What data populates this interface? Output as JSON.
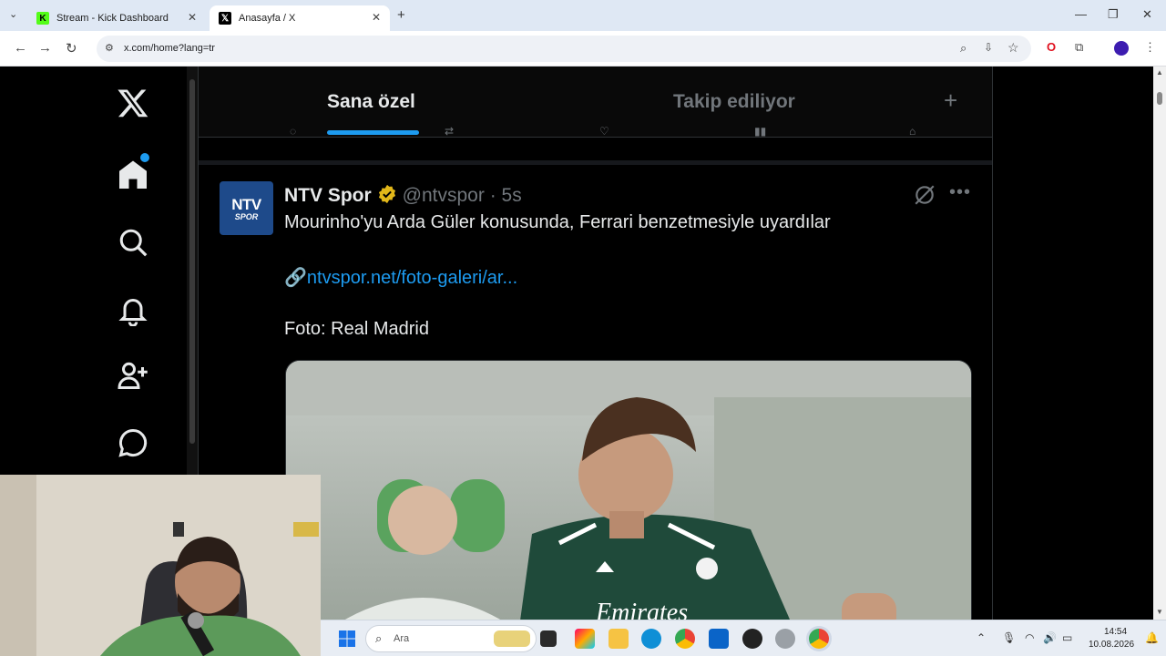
{
  "browser": {
    "tabs": [
      {
        "title": "Stream - Kick Dashboard",
        "favicon": "kick-icon"
      },
      {
        "title": "Anasayfa / X",
        "favicon": "x-icon"
      }
    ],
    "url": "x.com/home?lang=tr"
  },
  "feed": {
    "tab_for_you": "Sana özel",
    "tab_following": "Takip ediliyor"
  },
  "post": {
    "avatar_line1": "NTV",
    "avatar_line2": "SPOR",
    "author_name": "NTV Spor",
    "author_handle": "@ntvspor",
    "separator": "·",
    "time": "5s",
    "text": "Mourinho'yu Arda Güler konusunda, Ferrari benzetmesiyle uyardılar",
    "link_icon": "🔗",
    "link": "ntvspor.net/foto-galeri/ar...",
    "photo_credit": "Foto: Real Madrid",
    "image_text": "Emirates"
  },
  "taskbar": {
    "search_placeholder": "Ara",
    "time": "14:54",
    "date": "10.08.2026"
  },
  "colors": {
    "accent": "#1d9bf0",
    "text_primary": "#e7e9ea",
    "text_secondary": "#71767b",
    "verified": "#e2b719"
  }
}
